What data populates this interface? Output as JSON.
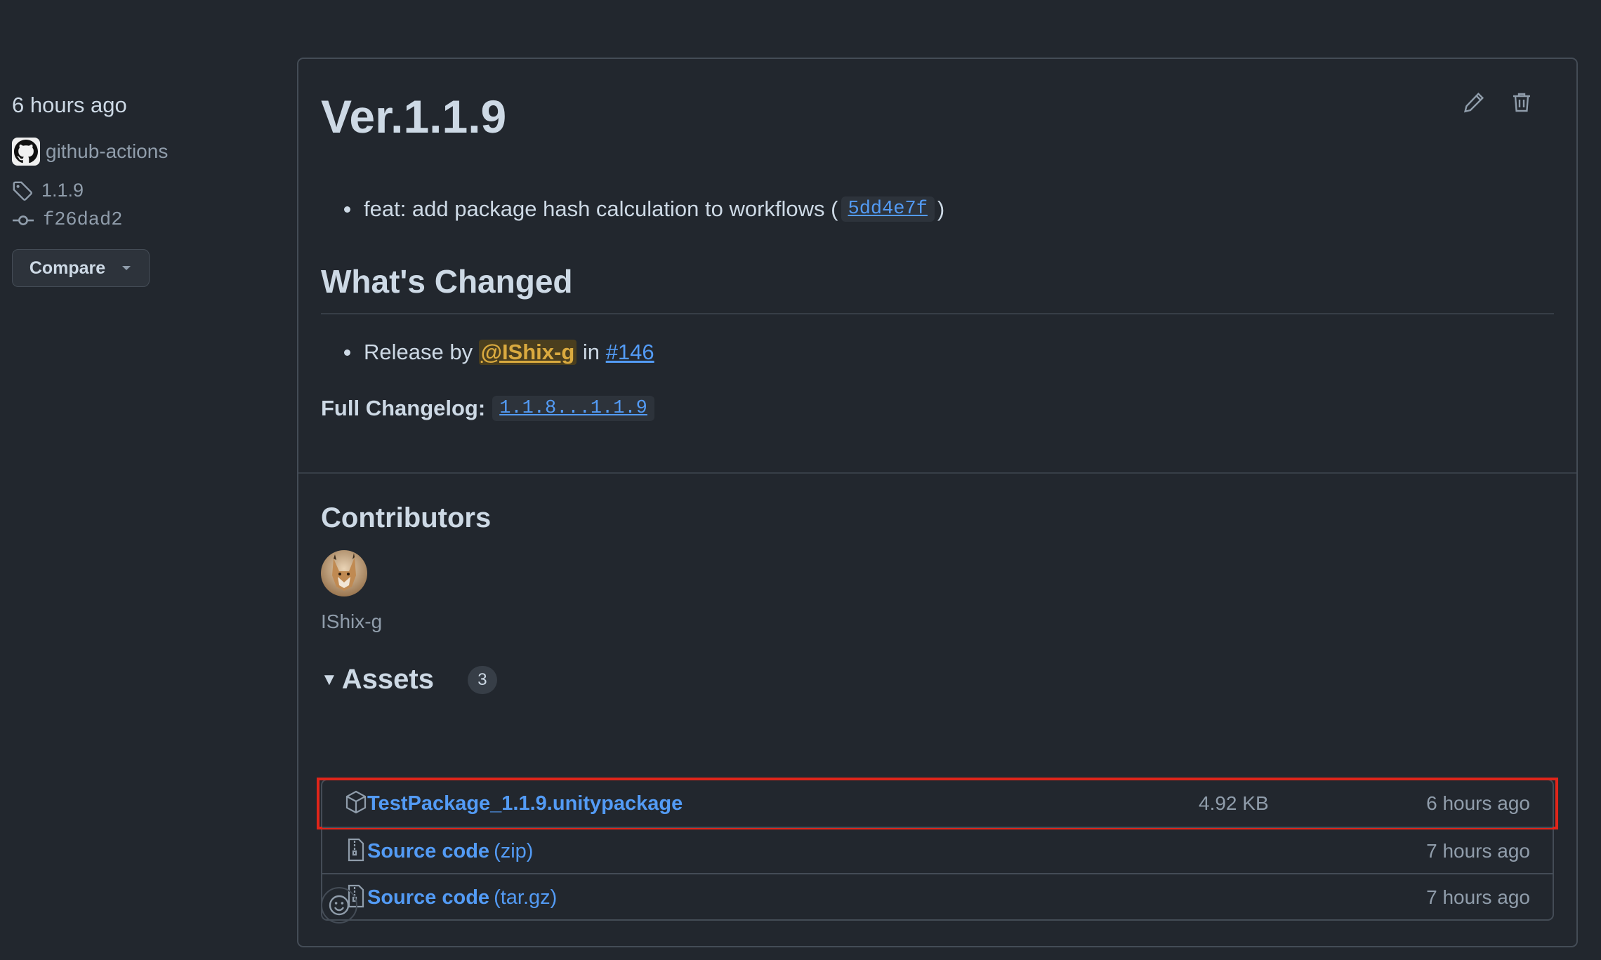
{
  "sidebar": {
    "time": "6 hours ago",
    "author": "github-actions",
    "tag": "1.1.9",
    "commit": "f26dad2",
    "compare_label": "Compare"
  },
  "release": {
    "title": "Ver.1.1.9",
    "bullet1_text": "feat: add package hash calculation to workflows (",
    "bullet1_commit": "5dd4e7f",
    "bullet1_close": ")",
    "section_heading": "What's Changed",
    "bullet2_prefix": "Release by",
    "bullet2_mention": "@IShix-g",
    "bullet2_in": "in",
    "bullet2_pr": "#146",
    "changelog_label": "Full Changelog:",
    "changelog_link": "1.1.8...1.1.9"
  },
  "contributors": {
    "heading": "Contributors",
    "names": [
      "IShix-g"
    ]
  },
  "assets": {
    "heading": "Assets",
    "count": "3",
    "items": [
      {
        "name": "TestPackage_1.1.9.unitypackage",
        "ext": "",
        "size": "4.92 KB",
        "time": "6 hours ago",
        "icon": "package-icon"
      },
      {
        "name": "Source code",
        "ext": "(zip)",
        "size": "",
        "time": "7 hours ago",
        "icon": "file-zip-icon"
      },
      {
        "name": "Source code",
        "ext": "(tar.gz)",
        "size": "",
        "time": "7 hours ago",
        "icon": "file-zip-icon"
      }
    ]
  },
  "colors": {
    "background": "#22272e",
    "link": "#539bf5",
    "mention": "#daaa3f",
    "highlight": "#e0251a"
  }
}
